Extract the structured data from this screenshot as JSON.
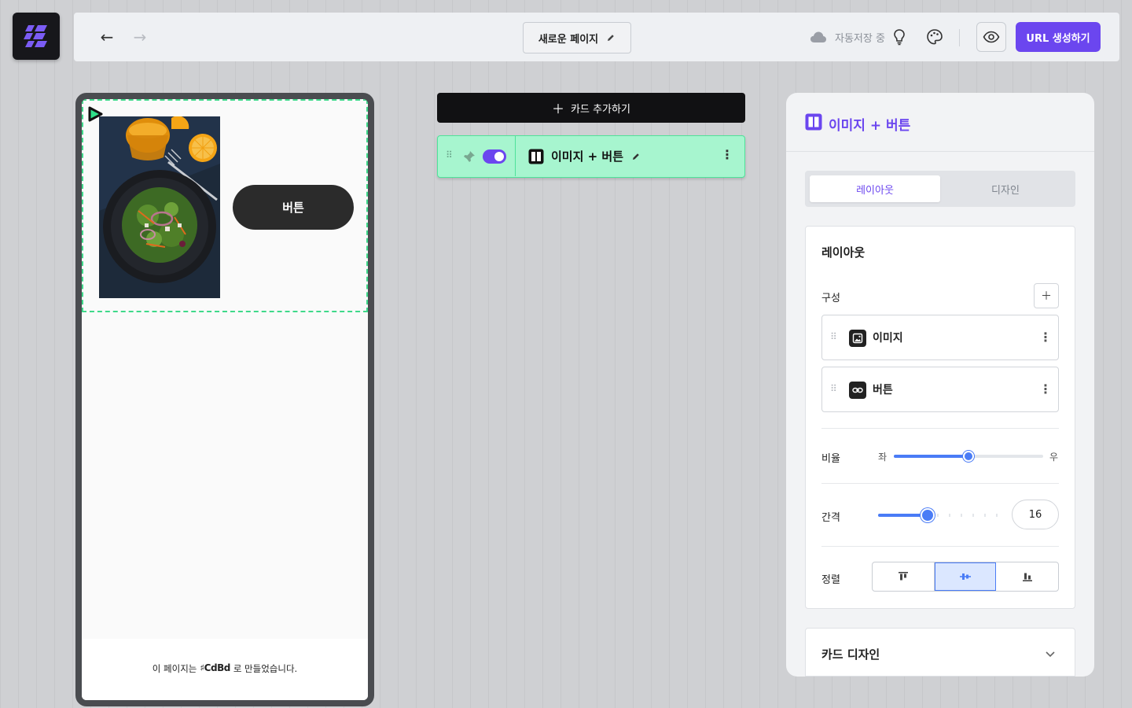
{
  "app": {
    "logo": "cdbd-logo-icon"
  },
  "toolbar": {
    "back": "←",
    "forward": "→",
    "page_title": "새로운 페이지",
    "autosave": "자동저장 중",
    "url_button": "URL 생성하기",
    "accent_color": "#6b46ef"
  },
  "phone": {
    "button_label": "버튼",
    "footer_pre": "이 페이지는",
    "footer_brand": "CdBd",
    "footer_post": "로 만들었습니다."
  },
  "cards": {
    "add_label": "카드 추가하기",
    "items": [
      {
        "title": "이미지 + 버튼",
        "enabled": true
      }
    ]
  },
  "panel": {
    "title": "이미지 + 버튼",
    "tabs": [
      {
        "label": "레이아웃",
        "active": true
      },
      {
        "label": "디자인",
        "active": false
      }
    ],
    "layout": {
      "section_title": "레이아웃",
      "composition_label": "구성",
      "components": [
        {
          "label": "이미지",
          "icon": "image-icon"
        },
        {
          "label": "버튼",
          "icon": "link-icon"
        }
      ],
      "ratio": {
        "label": "비율",
        "left": "좌",
        "right": "우",
        "value": 0.5
      },
      "gap": {
        "label": "간격",
        "value": "16"
      },
      "align": {
        "label": "정렬",
        "options": [
          "top",
          "center",
          "bottom"
        ],
        "selected": "center"
      }
    },
    "card_design": {
      "title": "카드 디자인"
    }
  }
}
